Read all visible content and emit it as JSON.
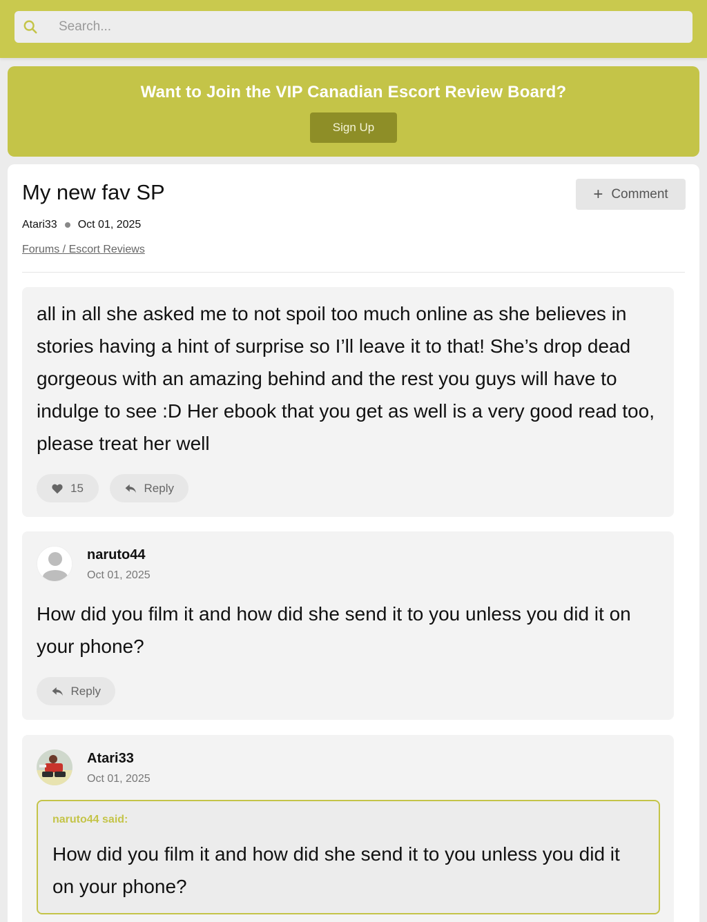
{
  "search": {
    "placeholder": "Search...",
    "icon": "search-icon"
  },
  "banner": {
    "title": "Want to Join the VIP Canadian Escort Review Board?",
    "signup_label": "Sign Up"
  },
  "thread": {
    "title": "My new fav SP",
    "comment_label": "Comment",
    "author": "Atari33",
    "date": "Oct 01, 2025",
    "breadcrumb": "Forums / Escort Reviews"
  },
  "main_post": {
    "body": "all in all she asked me to not spoil too much online as she believes in stories having a hint of surprise so I’ll leave it to that! She’s drop dead gorgeous with an amazing behind and the rest you guys will have to indulge to see :D Her ebook that you get as well is a very good read too, please treat her well",
    "likes": "15",
    "reply_label": "Reply"
  },
  "comments": [
    {
      "author": "naruto44",
      "date": "Oct 01, 2025",
      "body": "How did you film it and how did she send it to you unless you did it on your phone?",
      "reply_label": "Reply"
    },
    {
      "author": "Atari33",
      "date": "Oct 01, 2025",
      "quote_label": "naruto44 said:",
      "quote_body": "How did you film it and how did she send it to you unless you did it on your phone?"
    }
  ],
  "colors": {
    "accent": "#c9c94e",
    "button_dark": "#8e8e27",
    "card": "#ffffff",
    "post_bg": "#f3f3f3"
  }
}
